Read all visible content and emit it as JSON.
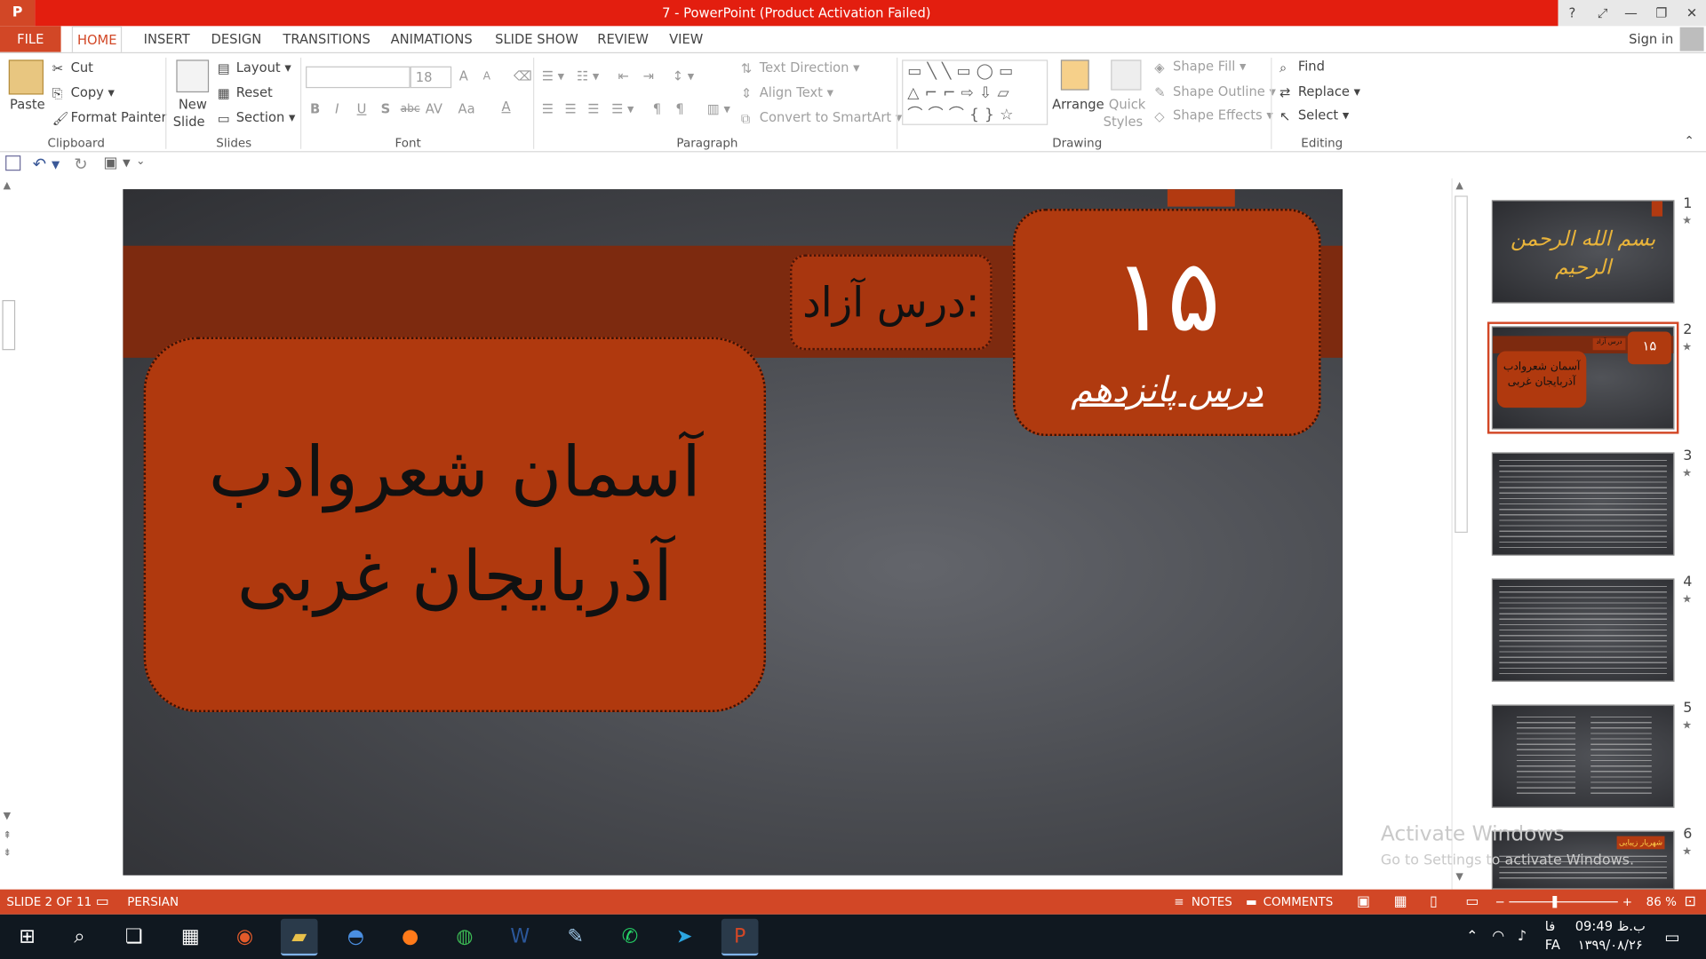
{
  "window": {
    "title": "7 -  PowerPoint (Product Activation Failed)",
    "controls": [
      "?",
      "⤢",
      "—",
      "❐",
      "✕"
    ]
  },
  "tabs": [
    "FILE",
    "HOME",
    "INSERT",
    "DESIGN",
    "TRANSITIONS",
    "ANIMATIONS",
    "SLIDE SHOW",
    "REVIEW",
    "VIEW"
  ],
  "account": {
    "signin": "Sign in"
  },
  "ribbon": {
    "clipboard": {
      "paste": "Paste",
      "cut": "Cut",
      "copy": "Copy",
      "format_painter": "Format Painter",
      "label": "Clipboard"
    },
    "slides": {
      "new_slide_1": "New",
      "new_slide_2": "Slide",
      "layout": "Layout",
      "reset": "Reset",
      "section": "Section",
      "label": "Slides"
    },
    "font": {
      "size": "18",
      "label": "Font",
      "bold": "B",
      "italic": "I",
      "underline": "U",
      "shadow": "S",
      "strike": "abc",
      "spacing": "AV",
      "case": "Aa",
      "color": "A",
      "grow": "A",
      "shrink": "A"
    },
    "paragraph": {
      "text_direction": "Text Direction",
      "align_text": "Align Text",
      "convert_smartart": "Convert to SmartArt",
      "label": "Paragraph"
    },
    "drawing": {
      "arrange": "Arrange",
      "quick_styles_1": "Quick",
      "quick_styles_2": "Styles",
      "shape_fill": "Shape Fill",
      "shape_outline": "Shape Outline",
      "shape_effects": "Shape Effects",
      "label": "Drawing"
    },
    "editing": {
      "find": "Find",
      "replace": "Replace",
      "select": "Select",
      "label": "Editing"
    }
  },
  "slide": {
    "lesson_label": "درس آزاد:",
    "number": "۱۵",
    "number_sub": "درس پانزدهم",
    "title_line1": "آسمان شعروادب",
    "title_line2": "آذربایجان غربی"
  },
  "thumbnails": [
    {
      "num": "1",
      "text": "بسم الله الرحمن الرحیم"
    },
    {
      "num": "2",
      "text_num": "۱۵",
      "text_title": "آسمان شعروادب آذربایجان غربی",
      "text_label": "درس آزاد"
    },
    {
      "num": "3"
    },
    {
      "num": "4"
    },
    {
      "num": "5"
    },
    {
      "num": "6",
      "text": "شهریار زیبایی"
    }
  ],
  "watermark": {
    "line1": "Activate Windows",
    "line2": "Go to Settings to activate Windows."
  },
  "status": {
    "slide": "SLIDE 2 OF 11",
    "language": "PERSIAN",
    "notes": "NOTES",
    "comments": "COMMENTS",
    "zoom": "86 %"
  },
  "taskbar": {
    "time": "09:49 ب.ظ",
    "date": "۱۳۹۹/۰۸/۲۶",
    "lang_top": "فا",
    "lang_bottom": "FA"
  },
  "colors": {
    "accent": "#d24726",
    "title_red": "#e31e0f",
    "slide_orange": "#b0390e",
    "band": "#7d2a0f"
  }
}
